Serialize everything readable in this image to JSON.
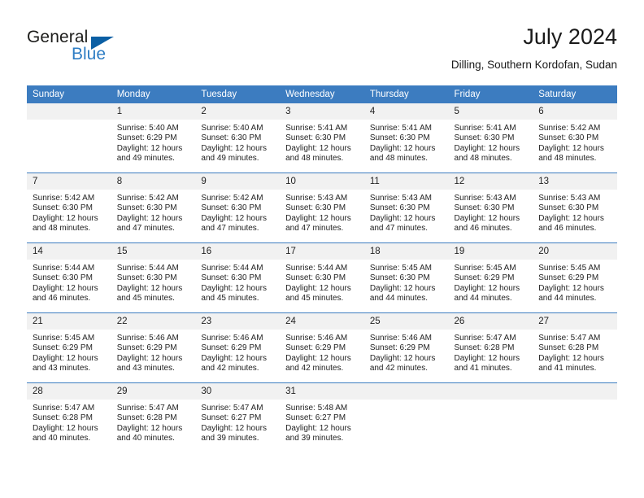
{
  "brand": {
    "word_one": "General",
    "word_two": "Blue",
    "triangle_icon": "brand-triangle-icon",
    "accent_color": "#2e7dc4",
    "triangle_color": "#0b5fa4"
  },
  "header": {
    "title": "July 2024",
    "subtitle": "Dilling, Southern Kordofan, Sudan"
  },
  "theme": {
    "header_bg": "#3c7cc0",
    "daynum_bg": "#f1f1f1",
    "rule_color": "#3c7cc0",
    "text_color": "#222222"
  },
  "weekdays": [
    "Sunday",
    "Monday",
    "Tuesday",
    "Wednesday",
    "Thursday",
    "Friday",
    "Saturday"
  ],
  "labels": {
    "sunrise_prefix": "Sunrise:",
    "sunset_prefix": "Sunset:",
    "daylight_prefix": "Daylight:"
  },
  "weeks": [
    [
      {
        "day": "",
        "sunrise": "",
        "sunset": "",
        "daylight_line1": "",
        "daylight_line2": ""
      },
      {
        "day": "1",
        "sunrise": "Sunrise: 5:40 AM",
        "sunset": "Sunset: 6:29 PM",
        "daylight_line1": "Daylight: 12 hours",
        "daylight_line2": "and 49 minutes."
      },
      {
        "day": "2",
        "sunrise": "Sunrise: 5:40 AM",
        "sunset": "Sunset: 6:30 PM",
        "daylight_line1": "Daylight: 12 hours",
        "daylight_line2": "and 49 minutes."
      },
      {
        "day": "3",
        "sunrise": "Sunrise: 5:41 AM",
        "sunset": "Sunset: 6:30 PM",
        "daylight_line1": "Daylight: 12 hours",
        "daylight_line2": "and 48 minutes."
      },
      {
        "day": "4",
        "sunrise": "Sunrise: 5:41 AM",
        "sunset": "Sunset: 6:30 PM",
        "daylight_line1": "Daylight: 12 hours",
        "daylight_line2": "and 48 minutes."
      },
      {
        "day": "5",
        "sunrise": "Sunrise: 5:41 AM",
        "sunset": "Sunset: 6:30 PM",
        "daylight_line1": "Daylight: 12 hours",
        "daylight_line2": "and 48 minutes."
      },
      {
        "day": "6",
        "sunrise": "Sunrise: 5:42 AM",
        "sunset": "Sunset: 6:30 PM",
        "daylight_line1": "Daylight: 12 hours",
        "daylight_line2": "and 48 minutes."
      }
    ],
    [
      {
        "day": "7",
        "sunrise": "Sunrise: 5:42 AM",
        "sunset": "Sunset: 6:30 PM",
        "daylight_line1": "Daylight: 12 hours",
        "daylight_line2": "and 48 minutes."
      },
      {
        "day": "8",
        "sunrise": "Sunrise: 5:42 AM",
        "sunset": "Sunset: 6:30 PM",
        "daylight_line1": "Daylight: 12 hours",
        "daylight_line2": "and 47 minutes."
      },
      {
        "day": "9",
        "sunrise": "Sunrise: 5:42 AM",
        "sunset": "Sunset: 6:30 PM",
        "daylight_line1": "Daylight: 12 hours",
        "daylight_line2": "and 47 minutes."
      },
      {
        "day": "10",
        "sunrise": "Sunrise: 5:43 AM",
        "sunset": "Sunset: 6:30 PM",
        "daylight_line1": "Daylight: 12 hours",
        "daylight_line2": "and 47 minutes."
      },
      {
        "day": "11",
        "sunrise": "Sunrise: 5:43 AM",
        "sunset": "Sunset: 6:30 PM",
        "daylight_line1": "Daylight: 12 hours",
        "daylight_line2": "and 47 minutes."
      },
      {
        "day": "12",
        "sunrise": "Sunrise: 5:43 AM",
        "sunset": "Sunset: 6:30 PM",
        "daylight_line1": "Daylight: 12 hours",
        "daylight_line2": "and 46 minutes."
      },
      {
        "day": "13",
        "sunrise": "Sunrise: 5:43 AM",
        "sunset": "Sunset: 6:30 PM",
        "daylight_line1": "Daylight: 12 hours",
        "daylight_line2": "and 46 minutes."
      }
    ],
    [
      {
        "day": "14",
        "sunrise": "Sunrise: 5:44 AM",
        "sunset": "Sunset: 6:30 PM",
        "daylight_line1": "Daylight: 12 hours",
        "daylight_line2": "and 46 minutes."
      },
      {
        "day": "15",
        "sunrise": "Sunrise: 5:44 AM",
        "sunset": "Sunset: 6:30 PM",
        "daylight_line1": "Daylight: 12 hours",
        "daylight_line2": "and 45 minutes."
      },
      {
        "day": "16",
        "sunrise": "Sunrise: 5:44 AM",
        "sunset": "Sunset: 6:30 PM",
        "daylight_line1": "Daylight: 12 hours",
        "daylight_line2": "and 45 minutes."
      },
      {
        "day": "17",
        "sunrise": "Sunrise: 5:44 AM",
        "sunset": "Sunset: 6:30 PM",
        "daylight_line1": "Daylight: 12 hours",
        "daylight_line2": "and 45 minutes."
      },
      {
        "day": "18",
        "sunrise": "Sunrise: 5:45 AM",
        "sunset": "Sunset: 6:30 PM",
        "daylight_line1": "Daylight: 12 hours",
        "daylight_line2": "and 44 minutes."
      },
      {
        "day": "19",
        "sunrise": "Sunrise: 5:45 AM",
        "sunset": "Sunset: 6:29 PM",
        "daylight_line1": "Daylight: 12 hours",
        "daylight_line2": "and 44 minutes."
      },
      {
        "day": "20",
        "sunrise": "Sunrise: 5:45 AM",
        "sunset": "Sunset: 6:29 PM",
        "daylight_line1": "Daylight: 12 hours",
        "daylight_line2": "and 44 minutes."
      }
    ],
    [
      {
        "day": "21",
        "sunrise": "Sunrise: 5:45 AM",
        "sunset": "Sunset: 6:29 PM",
        "daylight_line1": "Daylight: 12 hours",
        "daylight_line2": "and 43 minutes."
      },
      {
        "day": "22",
        "sunrise": "Sunrise: 5:46 AM",
        "sunset": "Sunset: 6:29 PM",
        "daylight_line1": "Daylight: 12 hours",
        "daylight_line2": "and 43 minutes."
      },
      {
        "day": "23",
        "sunrise": "Sunrise: 5:46 AM",
        "sunset": "Sunset: 6:29 PM",
        "daylight_line1": "Daylight: 12 hours",
        "daylight_line2": "and 42 minutes."
      },
      {
        "day": "24",
        "sunrise": "Sunrise: 5:46 AM",
        "sunset": "Sunset: 6:29 PM",
        "daylight_line1": "Daylight: 12 hours",
        "daylight_line2": "and 42 minutes."
      },
      {
        "day": "25",
        "sunrise": "Sunrise: 5:46 AM",
        "sunset": "Sunset: 6:29 PM",
        "daylight_line1": "Daylight: 12 hours",
        "daylight_line2": "and 42 minutes."
      },
      {
        "day": "26",
        "sunrise": "Sunrise: 5:47 AM",
        "sunset": "Sunset: 6:28 PM",
        "daylight_line1": "Daylight: 12 hours",
        "daylight_line2": "and 41 minutes."
      },
      {
        "day": "27",
        "sunrise": "Sunrise: 5:47 AM",
        "sunset": "Sunset: 6:28 PM",
        "daylight_line1": "Daylight: 12 hours",
        "daylight_line2": "and 41 minutes."
      }
    ],
    [
      {
        "day": "28",
        "sunrise": "Sunrise: 5:47 AM",
        "sunset": "Sunset: 6:28 PM",
        "daylight_line1": "Daylight: 12 hours",
        "daylight_line2": "and 40 minutes."
      },
      {
        "day": "29",
        "sunrise": "Sunrise: 5:47 AM",
        "sunset": "Sunset: 6:28 PM",
        "daylight_line1": "Daylight: 12 hours",
        "daylight_line2": "and 40 minutes."
      },
      {
        "day": "30",
        "sunrise": "Sunrise: 5:47 AM",
        "sunset": "Sunset: 6:27 PM",
        "daylight_line1": "Daylight: 12 hours",
        "daylight_line2": "and 39 minutes."
      },
      {
        "day": "31",
        "sunrise": "Sunrise: 5:48 AM",
        "sunset": "Sunset: 6:27 PM",
        "daylight_line1": "Daylight: 12 hours",
        "daylight_line2": "and 39 minutes."
      },
      {
        "day": "",
        "sunrise": "",
        "sunset": "",
        "daylight_line1": "",
        "daylight_line2": ""
      },
      {
        "day": "",
        "sunrise": "",
        "sunset": "",
        "daylight_line1": "",
        "daylight_line2": ""
      },
      {
        "day": "",
        "sunrise": "",
        "sunset": "",
        "daylight_line1": "",
        "daylight_line2": ""
      }
    ]
  ]
}
